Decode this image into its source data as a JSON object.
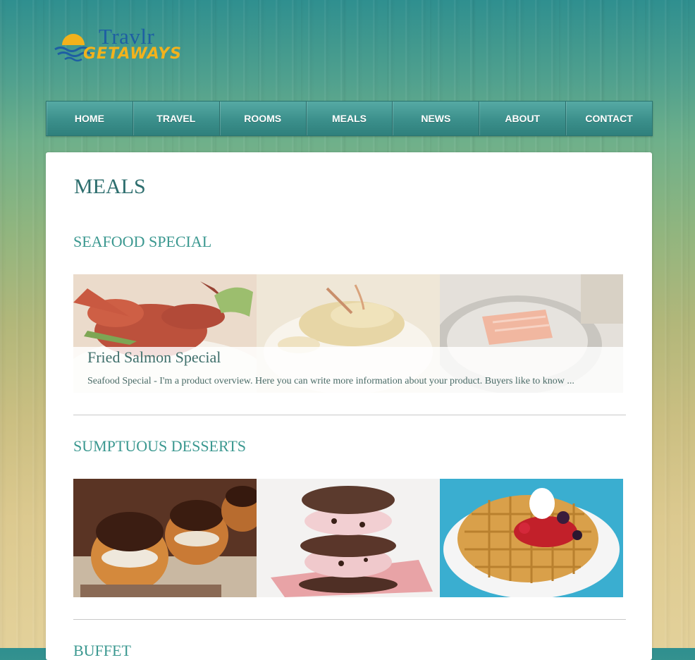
{
  "brand": {
    "line1": "Travlr",
    "line2": "GETAWAYS",
    "colors": {
      "blue": "#1e5fa3",
      "gold": "#f2b21c"
    }
  },
  "nav": {
    "items": [
      {
        "label": "HOME"
      },
      {
        "label": "TRAVEL"
      },
      {
        "label": "ROOMS"
      },
      {
        "label": "MEALS"
      },
      {
        "label": "NEWS"
      },
      {
        "label": "ABOUT"
      },
      {
        "label": "CONTACT"
      }
    ]
  },
  "page": {
    "title": "MEALS"
  },
  "sections": [
    {
      "title": "SEAFOOD SPECIAL",
      "images": [
        "lobster-image",
        "fish-fillet-image",
        "salmon-pan-image"
      ],
      "featured": {
        "name": "Fried Salmon Special",
        "description": "Seafood Special - I'm a product overview. Here you can write more information about your product. Buyers like to know ..."
      }
    },
    {
      "title": "SUMPTUOUS DESSERTS",
      "images": [
        "profiteroles-image",
        "ice-cream-sandwich-image",
        "waffle-image"
      ]
    },
    {
      "title": "BUFFET"
    }
  ],
  "theme": {
    "accent": "#3b9890",
    "nav_bg": "#3b8f8b",
    "title_color": "#2d6e6e"
  }
}
